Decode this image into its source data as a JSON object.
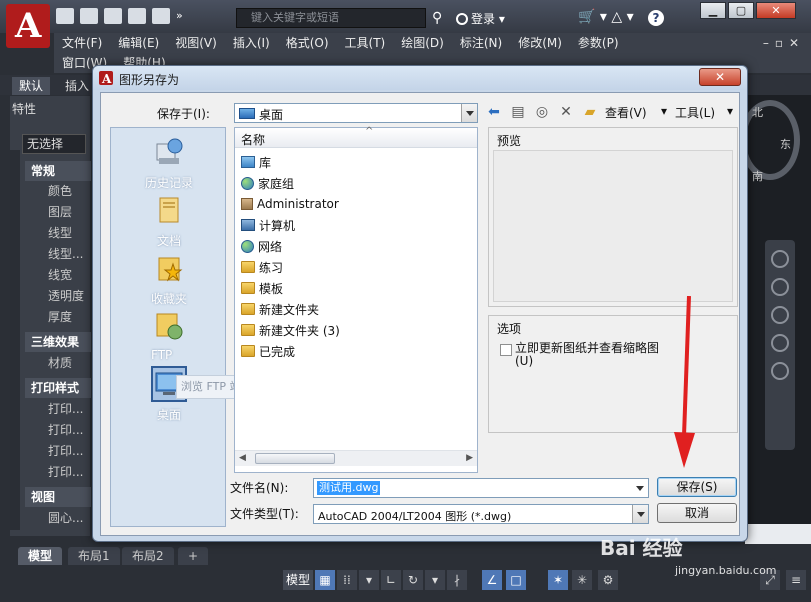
{
  "app": {
    "search_placeholder": "键入关键字或短语",
    "login": "登录",
    "menus_row1": [
      "文件(F)",
      "编辑(E)",
      "视图(V)",
      "插入(I)",
      "格式(O)",
      "工具(T)",
      "绘图(D)",
      "标注(N)",
      "修改(M)",
      "参数(P)"
    ],
    "menus_row2": [
      "窗口(W)",
      "帮助(H)"
    ],
    "ribbon_tabs": [
      "默认",
      "插入"
    ],
    "help_glyph": "?",
    "logo_letter": "A"
  },
  "properties": {
    "title": "特性",
    "selection": "无选择",
    "groups": [
      {
        "header": "常规",
        "items": [
          "颜色",
          "图层",
          "线型",
          "线型...",
          "线宽",
          "透明度",
          "厚度"
        ]
      },
      {
        "header": "三维效果",
        "items": [
          "材质"
        ]
      },
      {
        "header": "打印样式",
        "items": [
          "打印...",
          "打印...",
          "打印...",
          "打印..."
        ]
      },
      {
        "header": "视图",
        "items": [
          "圆心..."
        ]
      }
    ]
  },
  "viewcube": {
    "north": "北",
    "east": "东",
    "south": "南"
  },
  "layout_tabs": [
    "模型",
    "布局1",
    "布局2",
    "+"
  ],
  "statusbar": {
    "model": "模型"
  },
  "dialog": {
    "title": "图形另存为",
    "close": "✕",
    "save_in_label": "保存于(I):",
    "save_in_value": "桌面",
    "toolbar": {
      "view": "查看(V)",
      "tools": "工具(L)"
    },
    "places": [
      {
        "label": "历史记录",
        "icon": "history-icon"
      },
      {
        "label": "文档",
        "icon": "documents-icon"
      },
      {
        "label": "收藏夹",
        "icon": "favorites-icon"
      },
      {
        "label": "FTP",
        "icon": "ftp-icon"
      },
      {
        "label": "桌面",
        "icon": "desktop-icon"
      }
    ],
    "ftp_tooltip": "浏览 FTP 站点",
    "list_header": "名称",
    "files": [
      {
        "name": "库",
        "icon": "library-icon"
      },
      {
        "name": "家庭组",
        "icon": "homegroup-icon"
      },
      {
        "name": "Administrator",
        "icon": "user-folder-icon"
      },
      {
        "name": "计算机",
        "icon": "computer-icon"
      },
      {
        "name": "网络",
        "icon": "network-icon"
      },
      {
        "name": "练习",
        "icon": "folder-icon"
      },
      {
        "name": "模板",
        "icon": "folder-icon"
      },
      {
        "name": "新建文件夹",
        "icon": "folder-icon"
      },
      {
        "name": "新建文件夹 (3)",
        "icon": "folder-icon"
      },
      {
        "name": "已完成",
        "icon": "folder-icon"
      }
    ],
    "preview_label": "预览",
    "options_label": "选项",
    "checkbox_label": "立即更新图纸并查看缩略图(U)",
    "filename_label": "文件名(N):",
    "filename_value": "测试用.dwg",
    "filetype_label": "文件类型(T):",
    "filetype_value": "AutoCAD 2004/LT2004 图形 (*.dwg)",
    "save_button": "保存(S)",
    "cancel_button": "取消"
  },
  "watermark": {
    "brand": "Bai 经验",
    "url": "jingyan.baidu.com"
  },
  "colors": {
    "accent": "#3399ff",
    "arrow": "#e02020",
    "acad_red": "#b01c1c"
  }
}
